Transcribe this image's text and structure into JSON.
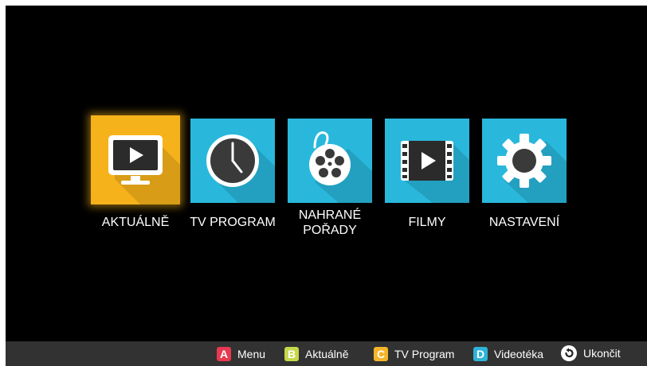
{
  "menu": {
    "items": [
      {
        "label": "AKTUÁLNĚ",
        "icon": "tv-play-icon",
        "focused": true
      },
      {
        "label": "TV PROGRAM",
        "icon": "clock-icon",
        "focused": false
      },
      {
        "label_line1": "NAHRANÉ",
        "label_line2": "POŘADY",
        "icon": "film-reel-icon",
        "focused": false
      },
      {
        "label": "FILMY",
        "icon": "film-strip-play-icon",
        "focused": false
      },
      {
        "label": "NASTAVENÍ",
        "icon": "gear-icon",
        "focused": false
      }
    ]
  },
  "bottom_bar": {
    "keys": [
      {
        "badge": "A",
        "label": "Menu",
        "color": "#e7394f"
      },
      {
        "badge": "B",
        "label": "Aktuálně",
        "color": "#c6d84a"
      },
      {
        "badge": "C",
        "label": "TV Program",
        "color": "#f5b52a"
      },
      {
        "badge": "D",
        "label": "Videotéka",
        "color": "#2eb4d8"
      }
    ],
    "exit": {
      "label": "Ukončit",
      "icon": "back-arrow-icon"
    }
  },
  "colors": {
    "tile": "#29b8dc",
    "tile_focused": "#f6b21b",
    "background": "#000000",
    "bar": "#323232"
  }
}
